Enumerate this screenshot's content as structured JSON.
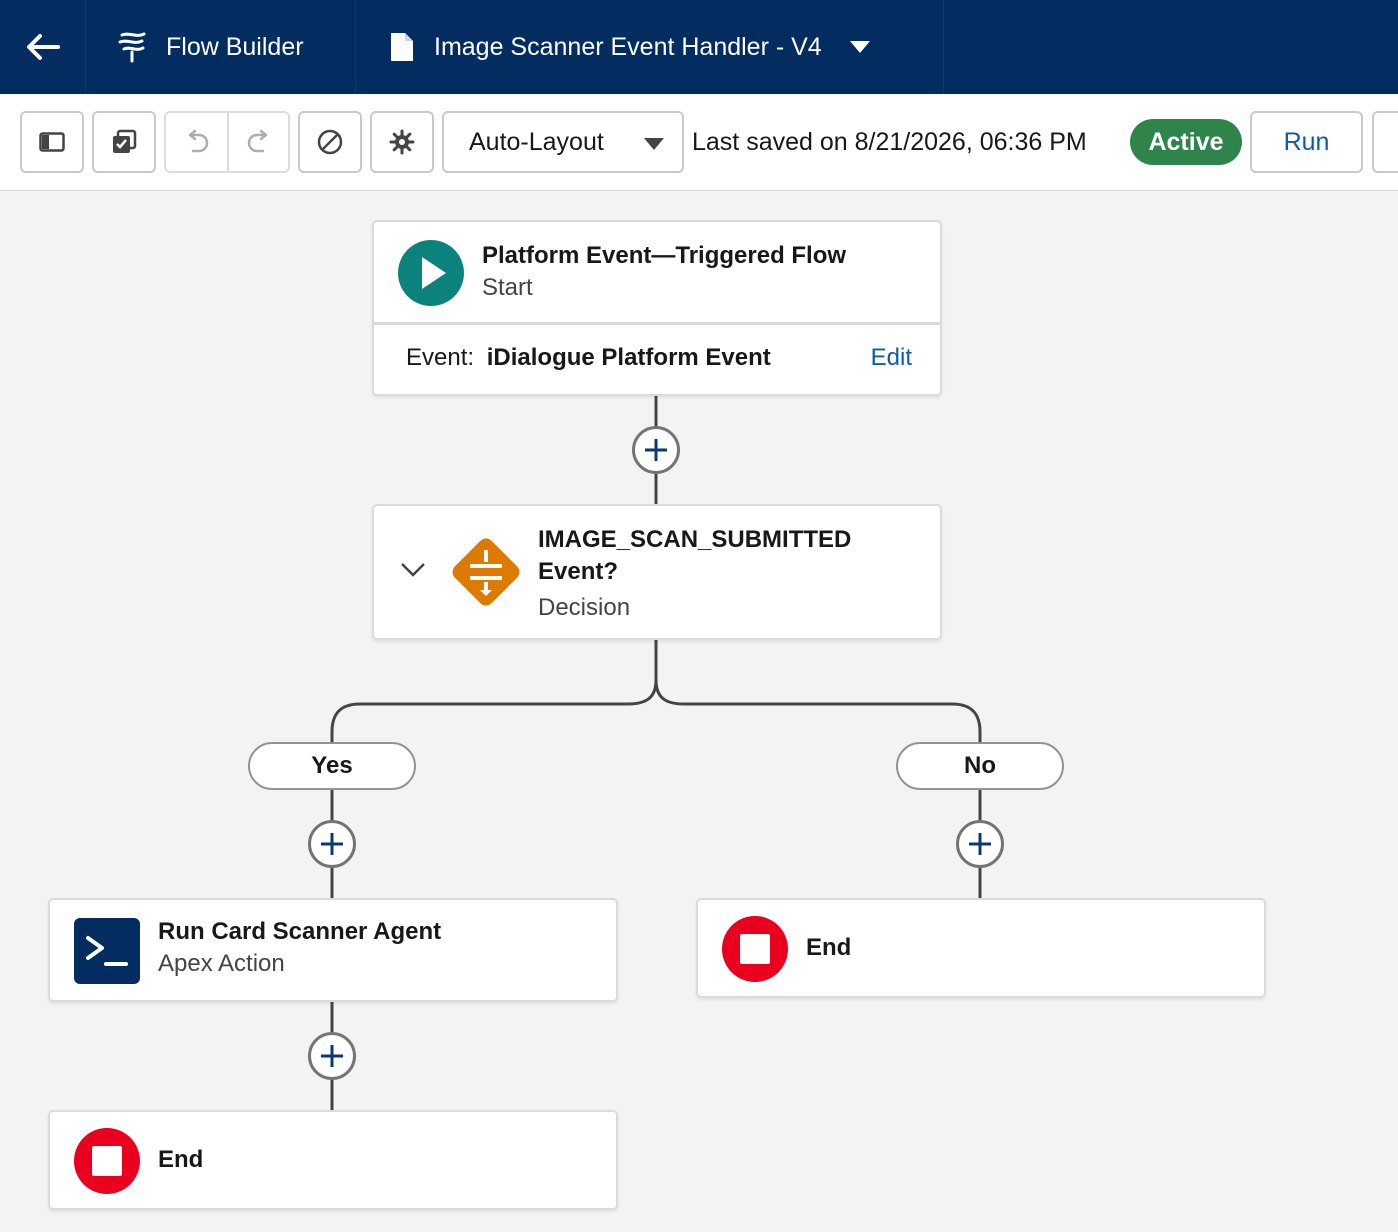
{
  "header": {
    "app_name": "Flow Builder",
    "flow_name": "Image Scanner Event Handler - V4"
  },
  "toolbar": {
    "layout_mode": "Auto-Layout",
    "last_saved": "Last saved on 8/21/2026, 06:36 PM",
    "status": "Active",
    "run_label": "Run"
  },
  "start_node": {
    "title": "Platform Event—Triggered Flow",
    "type": "Start",
    "event_label": "Event:",
    "event_name": "iDialogue Platform Event",
    "edit_label": "Edit"
  },
  "decision_node": {
    "title_line1": "IMAGE_SCAN_SUBMITTED",
    "title_line2": "Event?",
    "type": "Decision"
  },
  "branches": {
    "yes_label": "Yes",
    "no_label": "No"
  },
  "action_node": {
    "title": "Run Card Scanner Agent",
    "type": "Apex Action"
  },
  "end_nodes": {
    "yes_end_label": "End",
    "no_end_label": "End"
  },
  "colors": {
    "header_bg": "#032d60",
    "start_icon": "#0b827c",
    "decision_icon": "#dd7a01",
    "action_icon": "#032d60",
    "end_icon": "#ea001e",
    "active_badge": "#2e844a",
    "link": "#0b5cab"
  }
}
